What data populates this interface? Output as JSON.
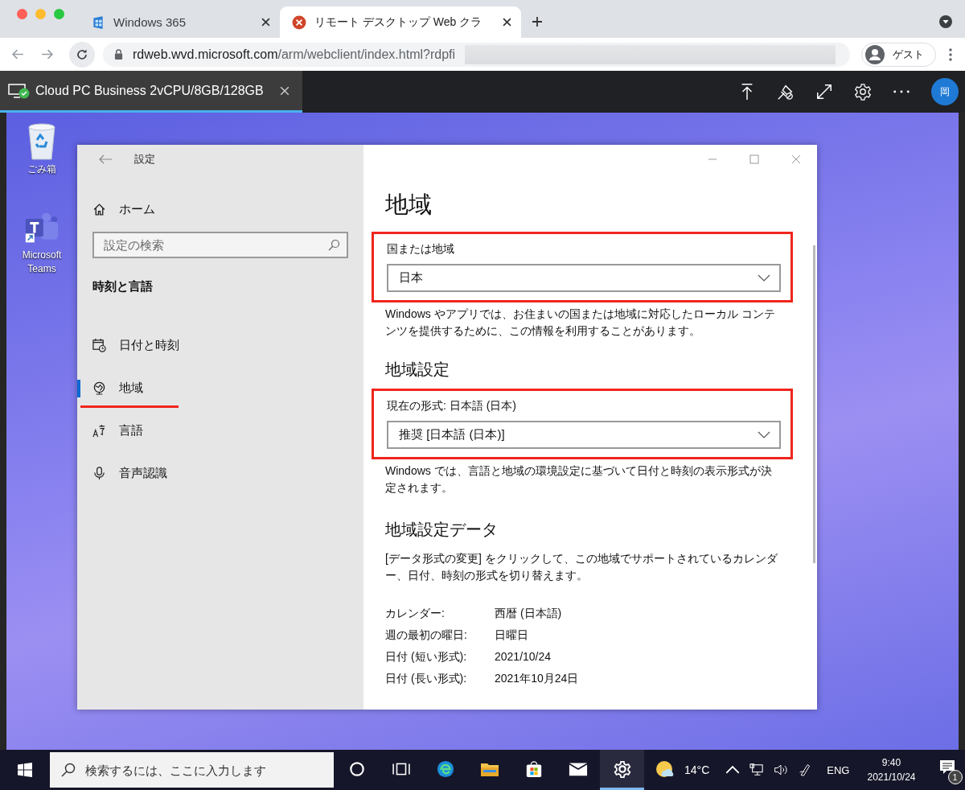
{
  "browser": {
    "tabs": [
      {
        "title": "Windows 365",
        "selected": false,
        "kind": "windows365"
      },
      {
        "title": "リモート デスクトップ Web クラ",
        "selected": true,
        "kind": "remote"
      }
    ],
    "url": {
      "host": "rdweb.wvd.microsoft.com",
      "path": "/arm/webclient/index.html?rdpfi"
    },
    "profile": "ゲスト"
  },
  "remote_toolbar": {
    "session_tab": "Cloud PC Business 2vCPU/8GB/128GB",
    "avatar": "岡"
  },
  "desktop_icons": [
    {
      "label": "ごみ箱",
      "kind": "recycle"
    },
    {
      "label": "Microsoft Teams",
      "kind": "teams"
    }
  ],
  "settings": {
    "title": "設定",
    "home": "ホーム",
    "search": {
      "placeholder": "設定の検索"
    },
    "section": "時刻と言語",
    "nav": [
      {
        "label": "日付と時刻",
        "kind": "calendar",
        "selected": false,
        "underlined": false
      },
      {
        "label": "地域",
        "kind": "globe",
        "selected": true,
        "underlined": true
      },
      {
        "label": "言語",
        "kind": "language",
        "selected": false,
        "underlined": false
      },
      {
        "label": "音声認識",
        "kind": "mic",
        "selected": false,
        "underlined": false
      }
    ],
    "heading": "地域",
    "country": {
      "label": "国または地域",
      "value": "日本",
      "highlighted": true
    },
    "country_note": "Windows やアプリでは、お住まいの国または地域に対応したローカル コンテンツを提供するために、この情報を利用することがあります。",
    "format_heading": "地域設定",
    "format": {
      "label": "現在の形式: 日本語 (日本)",
      "value": "推奨 [日本語 (日本)]",
      "highlighted": true
    },
    "format_note": "Windows では、言語と地域の環境設定に基づいて日付と時刻の表示形式が決定されます。",
    "data_heading": "地域設定データ",
    "data_note": "[データ形式の変更] をクリックして、この地域でサポートされているカレンダー、日付、時刻の形式を切り替えます。",
    "data_rows": [
      {
        "label": "カレンダー:",
        "value": "西暦 (日本語)"
      },
      {
        "label": "週の最初の曜日:",
        "value": "日曜日"
      },
      {
        "label": "日付 (短い形式):",
        "value": "2021/10/24"
      },
      {
        "label": "日付 (長い形式):",
        "value": "2021年10月24日"
      }
    ]
  },
  "taskbar": {
    "search": {
      "placeholder": "検索するには、ここに入力します"
    },
    "apps": [
      {
        "kind": "cortana",
        "active": false
      },
      {
        "kind": "taskview",
        "active": false
      },
      {
        "kind": "edge",
        "active": false
      },
      {
        "kind": "explorer",
        "active": false
      },
      {
        "kind": "store",
        "active": false
      },
      {
        "kind": "mail",
        "active": false
      },
      {
        "kind": "settings",
        "active": true
      }
    ],
    "temperature": "14°C",
    "language": "ENG",
    "time": "9:40",
    "date": "2021/10/24",
    "notifications": "1"
  }
}
